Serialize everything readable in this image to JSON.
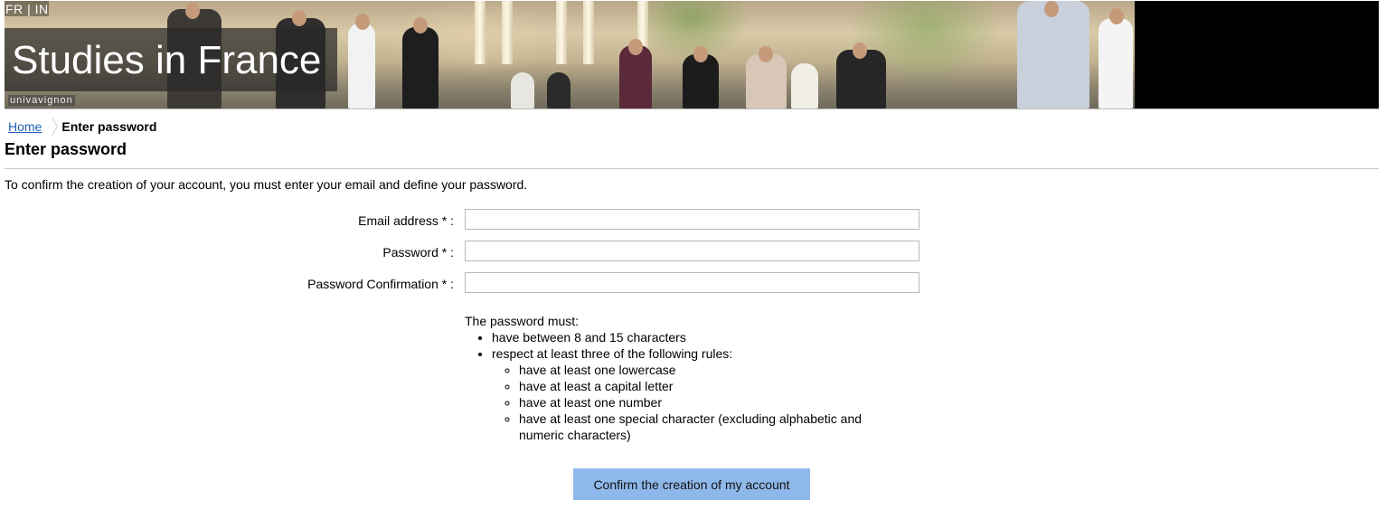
{
  "header": {
    "lang_fr": "FR",
    "lang_separator": "|",
    "lang_in": "IN",
    "title": "Studies in France",
    "logo_text": "univavignon"
  },
  "breadcrumb": {
    "home_label": "Home",
    "current_label": "Enter password"
  },
  "page": {
    "title": "Enter password",
    "intro": "To confirm the creation of your account, you must enter your email and define your password."
  },
  "form": {
    "email_label": "Email address * :",
    "email_value": "",
    "password_label": "Password * :",
    "password_value": "",
    "password_confirm_label": "Password Confirmation * :",
    "password_confirm_value": ""
  },
  "rules": {
    "heading": "The password must:",
    "length_rule": "have between 8 and 15 characters",
    "three_rules": "respect at least three of the following rules:",
    "sub_rules": [
      "have at least one lowercase",
      "have at least a capital letter",
      "have at least one number",
      "have at least one special character (excluding alphabetic and numeric characters)"
    ]
  },
  "actions": {
    "confirm_label": "Confirm the creation of my account"
  },
  "colors": {
    "button_bg": "#8eb8ea",
    "link": "#1f5fb4"
  }
}
